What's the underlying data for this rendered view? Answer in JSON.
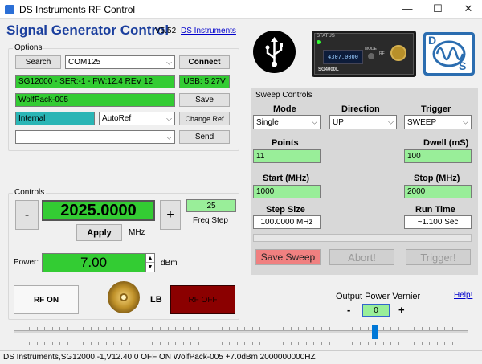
{
  "window": {
    "title": "DS Instruments RF Control",
    "minimize": "—",
    "maximize": "☐",
    "close": "✕"
  },
  "header": {
    "title": "Signal Generator Control",
    "version": "V5.52",
    "link": "DS Instruments"
  },
  "options": {
    "label": "Options",
    "search_button": "Search",
    "port_value": "COM125",
    "connect_button": "Connect",
    "device_info": "SG12000 - SER:-1 - FW:12.4 REV 12",
    "usb_voltage": "USB: 5.27V",
    "name_value": "WolfPack-005",
    "save_button": "Save",
    "ref_value": "Internal",
    "ref_mode": "AutoRef",
    "change_ref_button": "Change Ref",
    "command_value": "",
    "send_button": "Send"
  },
  "controls": {
    "label": "Controls",
    "minus": "-",
    "plus": "+",
    "frequency": "2025.0000",
    "apply_button": "Apply",
    "unit_mhz": "MHz",
    "freq_step_value": "25",
    "freq_step_label": "Freq Step",
    "power_label": "Power:",
    "power_value": "7.00",
    "power_unit": "dBm",
    "rf_on": "RF ON",
    "lb_label": "LB",
    "rf_off": "RF OFF"
  },
  "sweep": {
    "label": "Sweep Controls",
    "mode_label": "Mode",
    "mode_value": "Single",
    "direction_label": "Direction",
    "direction_value": "UP",
    "trigger_label": "Trigger",
    "trigger_value": "SWEEP",
    "points_label": "Points",
    "points_value": "11",
    "dwell_label": "Dwell (mS)",
    "dwell_value": "100",
    "start_label": "Start (MHz)",
    "start_value": "1000",
    "stop_label": "Stop (MHz)",
    "stop_value": "2000",
    "step_size_label": "Step Size",
    "step_size_value": "100.0000 MHz",
    "run_time_label": "Run Time",
    "run_time_value": "~1.100 Sec",
    "save_sweep": "Save Sweep",
    "abort": "Abort!",
    "trigger_button": "Trigger!"
  },
  "vernier": {
    "label": "Output Power Vernier",
    "minus": "-",
    "value": "0",
    "plus": "+",
    "help": "Help!"
  },
  "device_image": {
    "status_text": "STATUS",
    "display_text": "4307.0000",
    "mode_text": "MODE",
    "rf_text": "RF",
    "model_text": "SG4000L"
  },
  "logo": {
    "letters_top": "D",
    "letters_bottom": "S"
  },
  "status": "DS Instruments,SG12000,-1,V12.40  0  OFF  ON  WolfPack-005  +7.0dBm  2000000000HZ",
  "colors": {
    "accent": "#1b3f9e",
    "green": "#33cc33",
    "light_green": "#99ee99",
    "teal": "#2ab5b5",
    "rf_off": "#8b0000",
    "save_sweep": "#f08080"
  }
}
